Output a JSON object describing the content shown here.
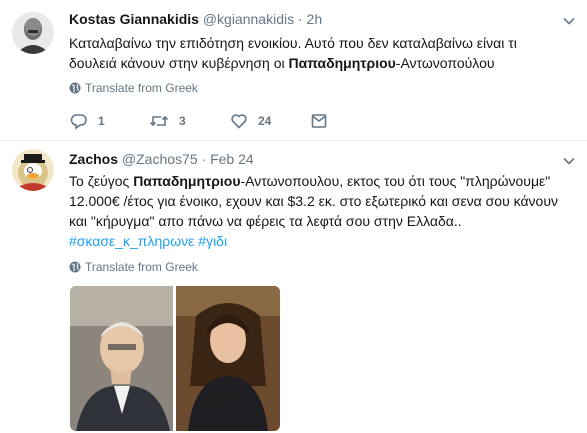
{
  "tweets": [
    {
      "display_name": "Kostas Giannakidis",
      "handle": "@kgiannakidis",
      "separator": "·",
      "time": "2h",
      "lines": [
        "Καταλαβαίνω την επιδότηση ενοικίου. Αυτό που δεν καταλαβαίνω είναι τι",
        [
          "δουλειά κάνουν στην κυβέρνηση οι ",
          "Παπαδημητριου",
          "-Αντωνοπούλου"
        ]
      ],
      "translate_label": "Translate from Greek",
      "reply_count": "1",
      "retweet_count": "3",
      "like_count": "24",
      "avatar_icon": "bald-man-avatar-icon"
    },
    {
      "display_name": "Zachos",
      "handle": "@Zachos75",
      "separator": "·",
      "time": "Feb 24",
      "lines": [
        [
          "Το ζεύγος ",
          "Παπαδημητριου",
          "-Αντωνοπουλου, εκτος του ότι τους \"πληρώνουμε\""
        ],
        "12.000€ /έτος για ένοικο, εχουν και $3.2 εκ. στο εξωτερικό και σενα σου κάνουν",
        "και \"κήρυγμα\" απο πάνω να φέρεις τα λεφτά σου στην Ελλαδα..",
        "#σκασε_κ_πληρωνε #γιδι"
      ],
      "hashtags": [
        "#σκασε_κ_πληρωνε",
        "#γιδι"
      ],
      "translate_label": "Translate from Greek",
      "avatar_icon": "scrooge-mcduck-avatar-icon"
    }
  ],
  "colors": {
    "text": "#14171a",
    "secondary": "#657786",
    "link": "#1da1f2",
    "divider": "#e6ecf0"
  }
}
